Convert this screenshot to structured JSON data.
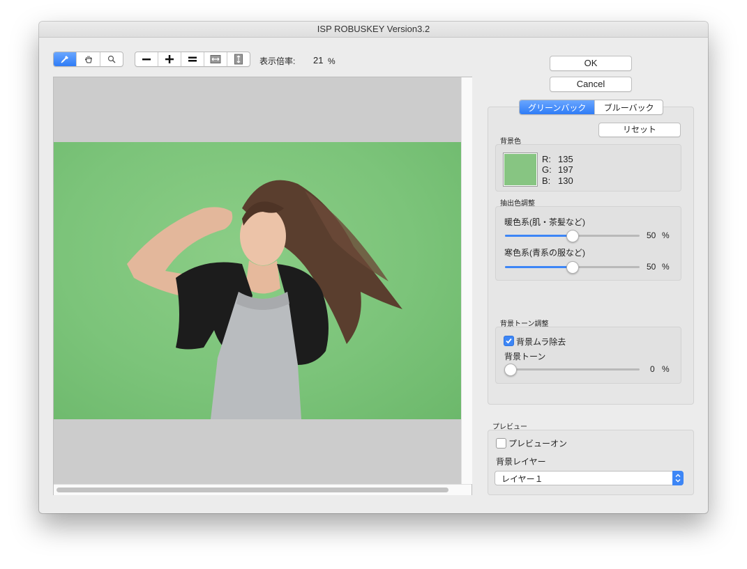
{
  "window": {
    "title": "ISP ROBUSKEY Version3.2"
  },
  "toolbar": {
    "zoom_label": "表示倍率:",
    "zoom_value": "21",
    "zoom_unit": "%"
  },
  "buttons": {
    "ok": "OK",
    "cancel": "Cancel",
    "reset": "リセット"
  },
  "tabs": [
    {
      "label": "グリーンバック",
      "selected": true
    },
    {
      "label": "ブルーバック",
      "selected": false
    }
  ],
  "background_color": {
    "label": "背景色",
    "swatch": "#87c582",
    "r_label": "R:",
    "r": "135",
    "g_label": "G:",
    "g": "197",
    "b_label": "B:",
    "b": "130"
  },
  "extraction": {
    "label": "抽出色調整",
    "warm": {
      "label": "暖色系(肌・茶髪など)",
      "value": "50",
      "unit": "%",
      "fraction": 0.5
    },
    "cool": {
      "label": "寒色系(青系の服など)",
      "value": "50",
      "unit": "%",
      "fraction": 0.5
    }
  },
  "tone": {
    "label": "背景トーン調整",
    "remove_unevenness": {
      "label": "背景ムラ除去",
      "checked": true
    },
    "tone_slider": {
      "label": "背景トーン",
      "value": "0",
      "unit": "%",
      "fraction": 0.0
    }
  },
  "preview": {
    "label": "プレビュー",
    "preview_on": {
      "label": "プレビューオン",
      "checked": false
    },
    "layer_label": "背景レイヤー",
    "layer_selected": "レイヤー１"
  },
  "colors": {
    "accent": "#3d86f6",
    "greenscreen": "#7cc47a",
    "canvas_bg": "#cccccc"
  }
}
